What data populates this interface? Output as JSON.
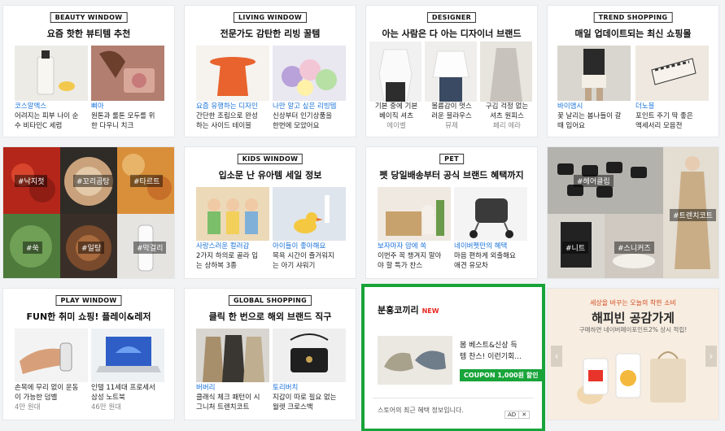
{
  "cards": {
    "beauty": {
      "tag": "BEAUTY WINDOW",
      "title": "요즘 핫한 뷰티템 추천",
      "products": [
        {
          "brand": "코스알엑스",
          "desc1": "어려지는 피부 나이 순",
          "desc2": "수 비타민C 세럼"
        },
        {
          "brand": "삐아",
          "desc1": "원톤과 룰톤 모두를 위",
          "desc2": "한 다우니 치크"
        }
      ]
    },
    "living": {
      "tag": "LIVING WINDOW",
      "title": "전문가도 감탄한 리빙 꿀템",
      "products": [
        {
          "brand": "요즘 유행하는 디자인",
          "desc1": "간단한 조립으로 완성",
          "desc2": "하는 사이드 테이블"
        },
        {
          "brand": "나만 알고 싶은 리빙템",
          "desc1": "신상부터 인기상품을",
          "desc2": "한번에 모았어요"
        }
      ]
    },
    "designer": {
      "tag": "DESIGNER",
      "title": "아는 사람은 다 아는 디자이너 브랜드",
      "products": [
        {
          "desc1": "기본 중에 기본",
          "desc2": "베이직 셔츠",
          "brand": "에이벨"
        },
        {
          "desc1": "볼륨감이 멋스",
          "desc2": "러운 블라우스",
          "brand": "뮤제"
        },
        {
          "desc1": "구김 걱정 없는",
          "desc2": "셔츠 원피스",
          "brand": "페리 에라"
        }
      ]
    },
    "trend": {
      "tag": "TREND SHOPPING",
      "title": "매일 업데이트되는 최신 쇼핑몰",
      "products": [
        {
          "brand": "바이앰시",
          "desc1": "꽃 날리는 봄나들이 갈",
          "desc2": "때 입어요"
        },
        {
          "brand": "더노블",
          "desc1": "포인트 주기 딱 좋은",
          "desc2": "액세서리 모음전"
        }
      ]
    },
    "food": {
      "tags": [
        "#낙지젓",
        "#꼬리곰탕",
        "#타르트",
        "#쑥",
        "#일탕",
        "#막걸리"
      ]
    },
    "kids": {
      "tag": "KIDS WINDOW",
      "title": "입소문 난 유아템 세일 정보",
      "products": [
        {
          "brand": "사랑스러운 컬러감",
          "desc1": "2가지 하의로 골라 입",
          "desc2": "는 상하복 3종"
        },
        {
          "brand": "아이들이 좋아해요",
          "desc1": "목욕 시간이 즐거워지",
          "desc2": "는 아기 샤워기"
        }
      ]
    },
    "pet": {
      "tag": "PET",
      "title": "펫 당일배송부터 공식 브랜드 혜택까지",
      "products": [
        {
          "brand": "보자마자 맘에 쏙",
          "desc1": "이번주 꼭 챙겨지 말아",
          "desc2": "야 할 특가 찬스"
        },
        {
          "brand": "네이버펫만의 혜택",
          "desc1": "마음 편하게 외출해요",
          "desc2": "애견 유모차"
        }
      ]
    },
    "fashion": {
      "tags": [
        "#헤어클립",
        "#트렌치코트",
        "#니트",
        "#스니커즈"
      ]
    },
    "play": {
      "tag": "PLAY WINDOW",
      "title": "FUN한 취미 쇼핑! 플레이&레저",
      "products": [
        {
          "desc1": "손목에 무리 없이 운동",
          "desc2": "이 가능한 덤벨",
          "price": "4만 원대"
        },
        {
          "desc1": "인텔 11세대 프로세서",
          "desc2": "삼성 노트북",
          "price": "46만 원대"
        }
      ]
    },
    "global": {
      "tag": "GLOBAL SHOPPING",
      "title": "클릭 한 번으로 해외 브랜드 직구",
      "products": [
        {
          "brand": "버버리",
          "desc1": "클래식 체크 패턴이 시",
          "desc2": "그니처 트렌치코트"
        },
        {
          "brand": "토리버치",
          "desc1": "지갑이 따로 필요 없는",
          "desc2": "월렛 크로스백"
        }
      ]
    }
  },
  "ad": {
    "store": "분홍코끼리",
    "new_label": "NEW",
    "desc1": "봄 베스트&신상 득",
    "desc2": "템 찬스! 이런기회...",
    "coupon": "COUPON 1,000원 할인",
    "footer": "스토어의 최근 혜택 정보입니다.",
    "ad_label": "AD",
    "close_label": "✕"
  },
  "happybean": {
    "sub": "세상을 바꾸는 오늘의 착한 소비",
    "title": "해피빈 공감가게",
    "desc": "구매하면 네이버페이포인트2% 상시 적립!",
    "prev": "‹",
    "next": "›"
  },
  "colors": {
    "accent_green": "#19a43a",
    "brand_blue": "#1a73d9",
    "new_red": "#e8261d"
  }
}
